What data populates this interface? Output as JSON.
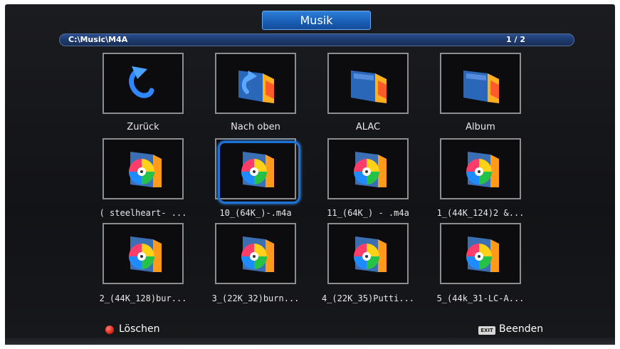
{
  "header": {
    "title": "Musik"
  },
  "pathbar": {
    "path": "C:\\Music\\M4A",
    "page": "1 / 2"
  },
  "grid": {
    "row1": [
      {
        "label": "Zurück",
        "icon": "back-arrow-icon"
      },
      {
        "label": "Nach oben",
        "icon": "folder-up-icon"
      },
      {
        "label": "ALAC",
        "icon": "folder-icon"
      },
      {
        "label": "Album",
        "icon": "folder-icon"
      }
    ],
    "row2": [
      {
        "label": "( steelheart-     ...",
        "icon": "music-file-icon"
      },
      {
        "label": "10_(64K_)-.m4a",
        "icon": "music-file-icon"
      },
      {
        "label": "11_(64K_) - .m4a",
        "icon": "music-file-icon"
      },
      {
        "label": "1_(44K_124)2 &...",
        "icon": "music-file-icon"
      }
    ],
    "row3": [
      {
        "label": "2_(44K_128)bur...",
        "icon": "music-file-icon"
      },
      {
        "label": "3_(22K_32)burn...",
        "icon": "music-file-icon"
      },
      {
        "label": "4_(22K_35)Putti...",
        "icon": "music-file-icon"
      },
      {
        "label": "5_(44k_31-LC-A...",
        "icon": "music-file-icon"
      }
    ]
  },
  "footer": {
    "delete_label": "Löschen",
    "exit_badge": "EXIT",
    "exit_label": "Beenden"
  },
  "colors": {
    "accent": "#1e74d6",
    "delete_button": "#d81e10"
  }
}
